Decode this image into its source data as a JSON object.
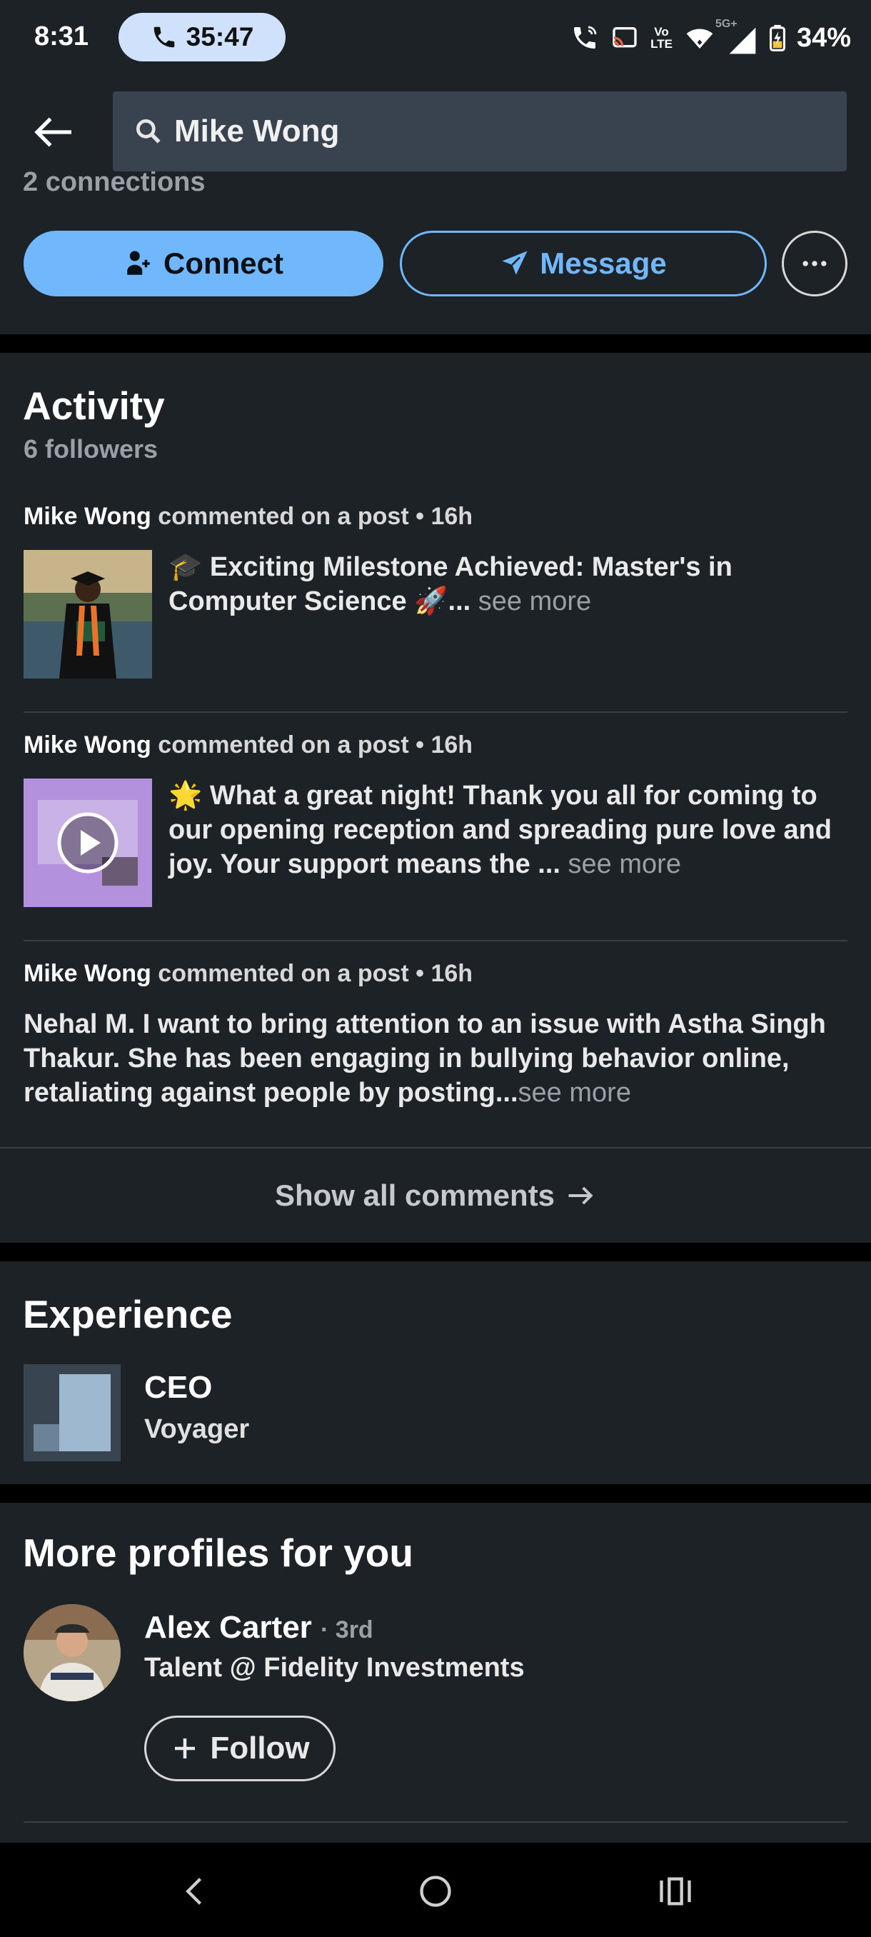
{
  "status_bar": {
    "time": "8:31",
    "call_timer": "35:47",
    "lte_label_top": "Vo",
    "lte_label_bottom": "LTE",
    "network_label": "5G+",
    "battery": "34%",
    "icons": [
      "wifi-calling-icon",
      "cast-icon",
      "volte-icon",
      "wifi-icon",
      "signal-icon",
      "battery-icon"
    ]
  },
  "app_bar": {
    "search_value": "Mike Wong"
  },
  "profile_actions": {
    "connections": "2 connections",
    "connect_label": "Connect",
    "message_label": "Message"
  },
  "activity": {
    "title": "Activity",
    "followers": "6 followers",
    "items": [
      {
        "name": "Mike Wong",
        "action": "commented on a post • 16h",
        "emoji": "🎓",
        "text": "Exciting Milestone Achieved: Master's in Computer Science 🚀...",
        "see_more": "see more"
      },
      {
        "name": "Mike Wong",
        "action": "commented on a post • 16h",
        "emoji": "🌟",
        "text": "What a great night! Thank you all for coming to our opening reception and spreading pure love and joy. Your support means the ...",
        "see_more": "see more"
      },
      {
        "name": "Mike Wong",
        "action": "commented on a post • 16h",
        "text": "Nehal M. I want to bring attention to an issue with Astha Singh Thakur. She has been engaging in bullying behavior online, retaliating against people by posting...",
        "see_more": "see more"
      }
    ],
    "show_all": "Show all comments"
  },
  "experience": {
    "title": "Experience",
    "role": "CEO",
    "company": "Voyager"
  },
  "more_profiles": {
    "title": "More profiles for you",
    "name": "Alex Carter",
    "degree": "· 3rd",
    "headline": "Talent @ Fidelity Investments",
    "follow_label": "Follow"
  },
  "colors": {
    "accent": "#71b7fb",
    "background": "#1d2226",
    "muted_text": "#9aa0a6"
  }
}
